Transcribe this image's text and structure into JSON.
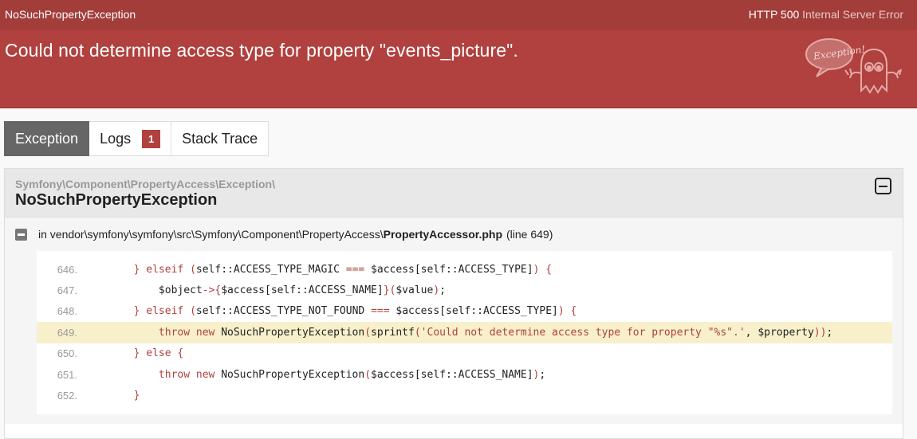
{
  "header": {
    "exception_class": "NoSuchPropertyException",
    "http_status": "HTTP 500",
    "http_text": "Internal Server Error",
    "message": "Could not determine access type for property \"events_picture\".",
    "mascot_icon": "exception-ghost-icon",
    "mascot_text": "Exception!"
  },
  "tabs": [
    {
      "label": "Exception",
      "active": true
    },
    {
      "label": "Logs",
      "badge": "1"
    },
    {
      "label": "Stack Trace"
    }
  ],
  "exception": {
    "namespace": "Symfony\\Component\\PropertyAccess\\Exception\\",
    "name": "NoSuchPropertyException",
    "trace": {
      "prefix": "in vendor\\symfony\\symfony\\src\\Symfony\\Component\\PropertyAccess\\",
      "file": "PropertyAccessor.php",
      "line": "(line 649)"
    },
    "code_lines": [
      {
        "num": "646.",
        "text": "        } elseif (self::ACCESS_TYPE_MAGIC === $access[self::ACCESS_TYPE]) {"
      },
      {
        "num": "647.",
        "text": "            $object->{$access[self::ACCESS_NAME]}($value);"
      },
      {
        "num": "648.",
        "text": "        } elseif (self::ACCESS_TYPE_NOT_FOUND === $access[self::ACCESS_TYPE]) {"
      },
      {
        "num": "649.",
        "text": "            throw new NoSuchPropertyException(sprintf('Could not determine access type for property \"%s\".', $property));",
        "highlighted": true
      },
      {
        "num": "650.",
        "text": "        } else {"
      },
      {
        "num": "651.",
        "text": "            throw new NoSuchPropertyException($access[self::ACCESS_NAME]);"
      },
      {
        "num": "652.",
        "text": "        }"
      }
    ]
  },
  "colors": {
    "header_bg": "#b0413e",
    "highlight": "#f7f0cb",
    "tab_active": "#666666"
  }
}
